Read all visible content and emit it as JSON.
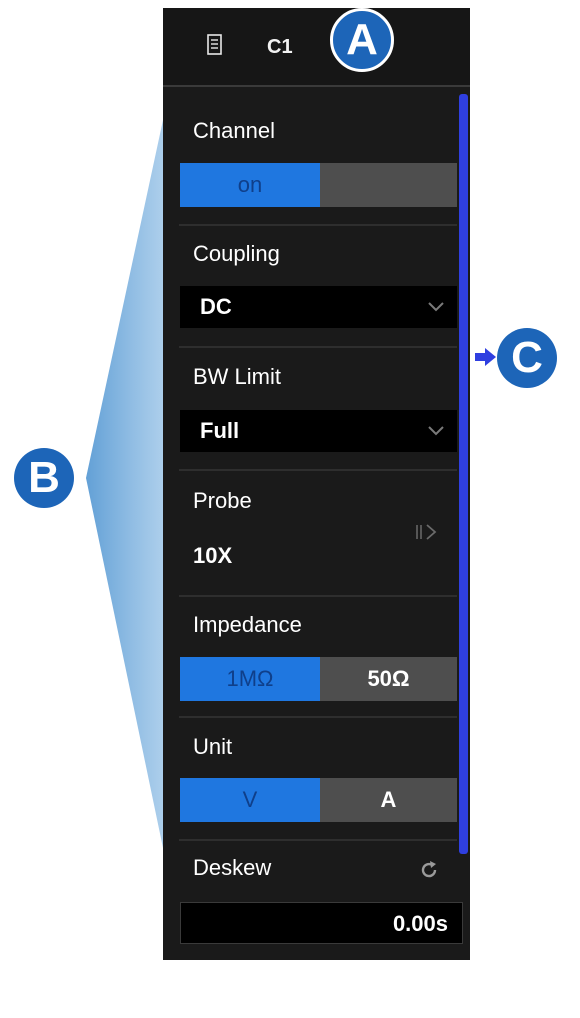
{
  "header": {
    "title": "C1",
    "icon": "document-icon"
  },
  "channel": {
    "label": "Channel",
    "options": [
      "on",
      ""
    ],
    "selected": "on"
  },
  "coupling": {
    "label": "Coupling",
    "value": "DC"
  },
  "bw_limit": {
    "label": "BW Limit",
    "value": "Full"
  },
  "probe": {
    "label": "Probe",
    "value": "10X"
  },
  "impedance": {
    "label": "Impedance",
    "options": [
      "1MΩ",
      "50Ω"
    ],
    "selected": "1MΩ"
  },
  "unit": {
    "label": "Unit",
    "options": [
      "V",
      "A"
    ],
    "selected": "V"
  },
  "deskew": {
    "label": "Deskew",
    "value": "0.00s"
  },
  "callouts": {
    "a": "A",
    "b": "B",
    "c": "C"
  },
  "colors": {
    "accent_blue": "#1f77e0",
    "panel_bg": "#1a1a1a",
    "callout_blue": "#1d65b8",
    "scrollbar": "#2f3fe0",
    "wedge": "#7fb3dd"
  }
}
